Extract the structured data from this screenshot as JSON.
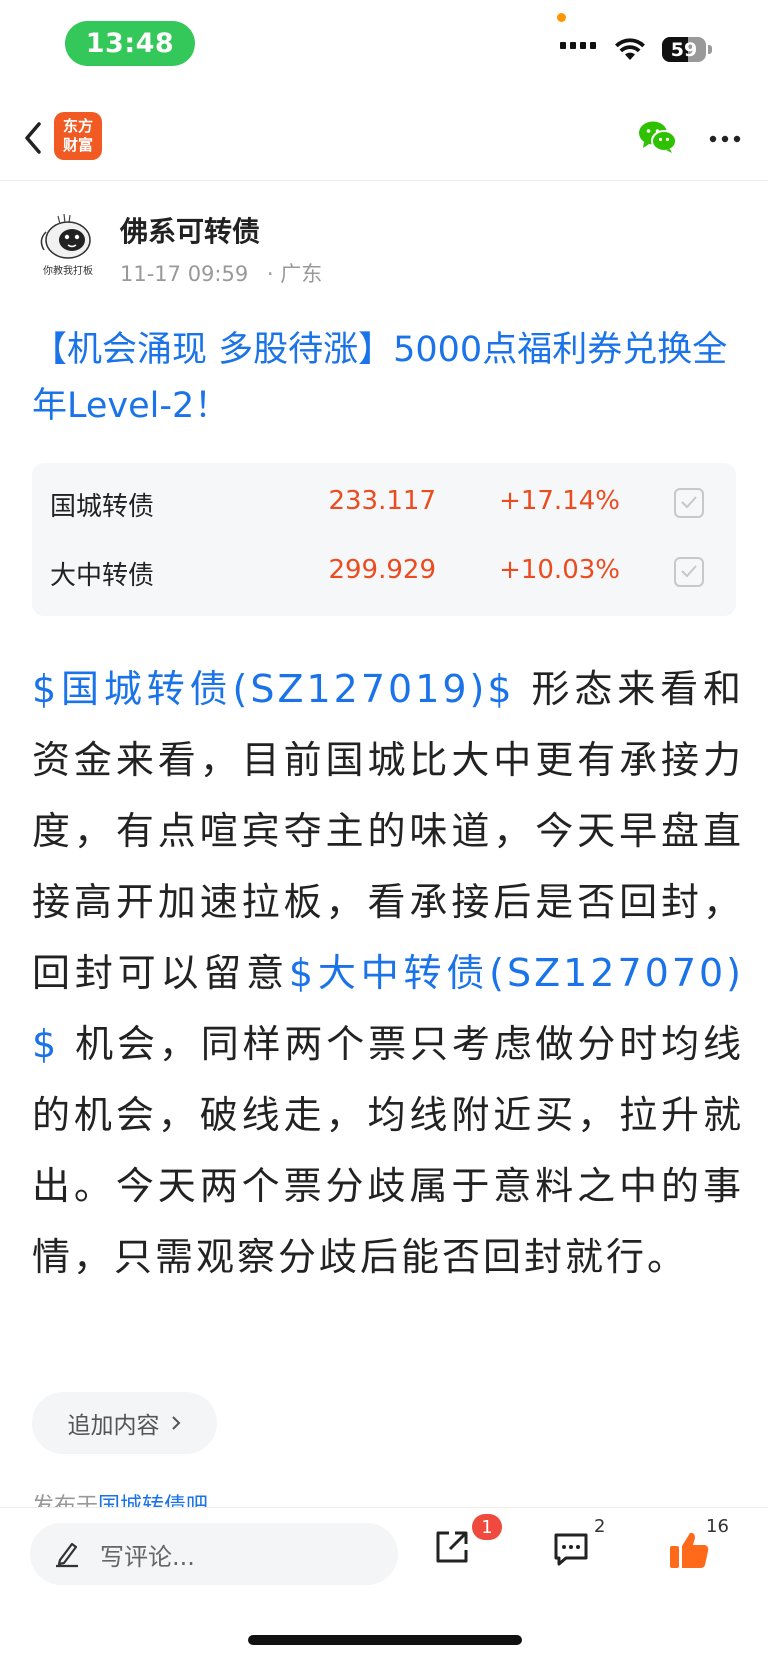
{
  "status_bar": {
    "time": "13:48",
    "battery": "59",
    "battery_level": 0.59
  },
  "nav": {
    "logo_line1": "东方",
    "logo_line2": "财富",
    "back_icon": "chevron-left-icon",
    "share_icon": "wechat-icon",
    "more_icon": "more-dots-icon"
  },
  "author": {
    "name": "佛系可转债",
    "avatar_caption": "你教我打板",
    "time": "11-17 09:59",
    "location": "· 广东"
  },
  "post": {
    "title": "【机会涌现 多股待涨】5000点福利券兑换全年Level-2！",
    "stocks": [
      {
        "name": "国城转债",
        "price": "233.117",
        "change": "+17.14%"
      },
      {
        "name": "大中转债",
        "price": "299.929",
        "change": "+10.03%"
      }
    ],
    "body": {
      "link1": "$国城转债(SZ127019)$",
      "text1": " 形态来看和资金来看，目前国城比大中更有承接力度，有点喧宾夺主的味道，今天早盘直接高开加速拉板，看承接后是否回封，回封可以留意",
      "link2": "$大中转债(SZ127070)$",
      "text2": " 机会，同样两个票只考虑做分时均线的机会，破线走，均线附近买，拉升就出。今天两个票分歧属于意料之中的事情，只需观察分歧后能否回封就行。"
    },
    "append_label": "追加内容",
    "posted_prefix": "发布于",
    "posted_bar": "国城转债吧"
  },
  "bottom_bar": {
    "comment_placeholder": "写评论...",
    "share_badge": "1",
    "comment_count": "2",
    "like_count": "16"
  },
  "colors": {
    "accent": "#1a73e8",
    "rise": "#ec4b1f",
    "brand": "#f15a22",
    "status_green": "#34c759",
    "like": "#ff6a1a"
  }
}
